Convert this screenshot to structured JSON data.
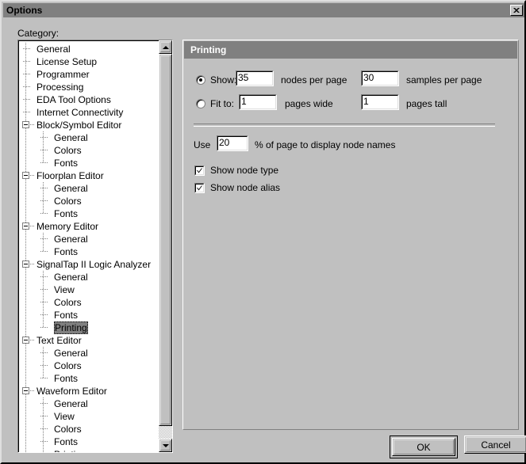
{
  "window": {
    "title": "Options",
    "close_icon": "close-x-icon"
  },
  "left": {
    "category_label": "Category:",
    "tree_items": [
      {
        "label": "General",
        "level": 0,
        "expander": false
      },
      {
        "label": "License Setup",
        "level": 0,
        "expander": false
      },
      {
        "label": "Programmer",
        "level": 0,
        "expander": false
      },
      {
        "label": "Processing",
        "level": 0,
        "expander": false
      },
      {
        "label": "EDA Tool Options",
        "level": 0,
        "expander": false
      },
      {
        "label": "Internet Connectivity",
        "level": 0,
        "expander": false
      },
      {
        "label": "Block/Symbol Editor",
        "level": 0,
        "expander": true
      },
      {
        "label": "General",
        "level": 1,
        "expander": false
      },
      {
        "label": "Colors",
        "level": 1,
        "expander": false
      },
      {
        "label": "Fonts",
        "level": 1,
        "expander": false
      },
      {
        "label": "Floorplan Editor",
        "level": 0,
        "expander": true
      },
      {
        "label": "General",
        "level": 1,
        "expander": false
      },
      {
        "label": "Colors",
        "level": 1,
        "expander": false
      },
      {
        "label": "Fonts",
        "level": 1,
        "expander": false
      },
      {
        "label": "Memory Editor",
        "level": 0,
        "expander": true
      },
      {
        "label": "General",
        "level": 1,
        "expander": false
      },
      {
        "label": "Fonts",
        "level": 1,
        "expander": false
      },
      {
        "label": "SignalTap II Logic Analyzer",
        "level": 0,
        "expander": true
      },
      {
        "label": "General",
        "level": 1,
        "expander": false
      },
      {
        "label": "View",
        "level": 1,
        "expander": false
      },
      {
        "label": "Colors",
        "level": 1,
        "expander": false
      },
      {
        "label": "Fonts",
        "level": 1,
        "expander": false
      },
      {
        "label": "Printing",
        "level": 1,
        "expander": false,
        "selected": true
      },
      {
        "label": "Text Editor",
        "level": 0,
        "expander": true
      },
      {
        "label": "General",
        "level": 1,
        "expander": false
      },
      {
        "label": "Colors",
        "level": 1,
        "expander": false
      },
      {
        "label": "Fonts",
        "level": 1,
        "expander": false
      },
      {
        "label": "Waveform Editor",
        "level": 0,
        "expander": true
      },
      {
        "label": "General",
        "level": 1,
        "expander": false
      },
      {
        "label": "View",
        "level": 1,
        "expander": false
      },
      {
        "label": "Colors",
        "level": 1,
        "expander": false
      },
      {
        "label": "Fonts",
        "level": 1,
        "expander": false
      },
      {
        "label": "Printing",
        "level": 1,
        "expander": false
      }
    ],
    "scrollbar": {
      "up_icon": "scroll-up-arrow-icon",
      "down_icon": "scroll-down-arrow-icon"
    }
  },
  "panel": {
    "header": "Printing",
    "show_radio_label": "Show:",
    "show_radio_selected": true,
    "nodes_per_page_value": "35",
    "nodes_per_page_label": "nodes per page",
    "samples_per_page_value": "30",
    "samples_per_page_label": "samples per page",
    "fitto_radio_label": "Fit to:",
    "fitto_radio_selected": false,
    "pages_wide_value": "1",
    "pages_wide_label": "pages wide",
    "pages_tall_value": "1",
    "pages_tall_label": "pages tall",
    "use_label": "Use",
    "use_percent_value": "20",
    "use_suffix_label": "% of page to display node names",
    "show_node_type_label": "Show node type",
    "show_node_type_checked": true,
    "show_node_alias_label": "Show node alias",
    "show_node_alias_checked": true,
    "check_icon": "checkmark-icon"
  },
  "footer": {
    "ok_label": "OK",
    "cancel_label": "Cancel"
  },
  "colors": {
    "face": "#c0c0c0",
    "titlebar": "#808080",
    "header_band": "#808080",
    "selection": "#808080",
    "field_bg": "#ffffff"
  }
}
